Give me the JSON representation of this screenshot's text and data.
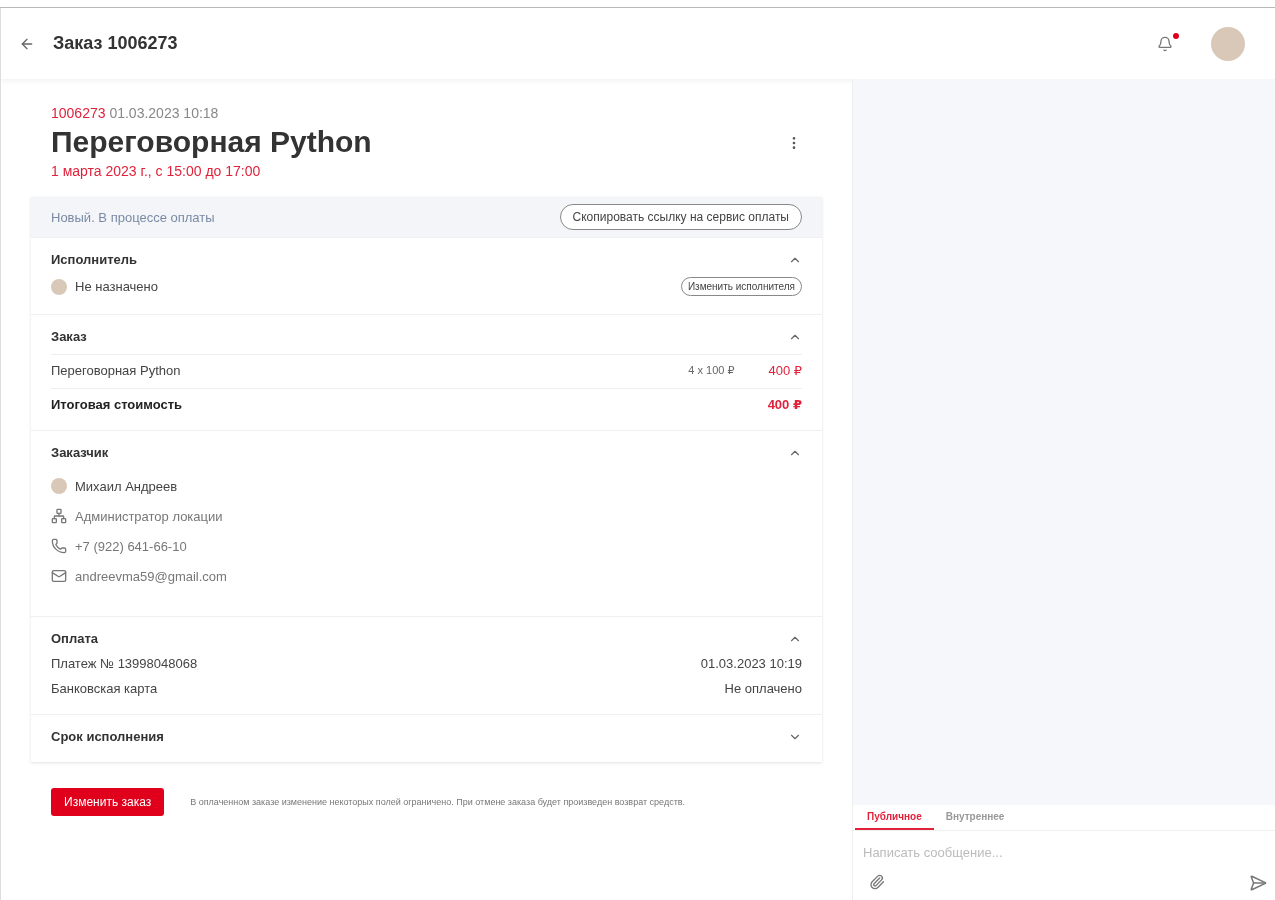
{
  "header": {
    "title": "Заказ 1006273",
    "has_notifications": true
  },
  "order": {
    "number": "1006273",
    "created": "01.03.2023 10:18",
    "title": "Переговорная Python",
    "schedule": "1 марта 2023 г., с 15:00 до 17:00"
  },
  "status_bar": {
    "status": "Новый. В процессе оплаты",
    "button": "Скопировать ссылку на сервис оплаты"
  },
  "sections": [
    {
      "kind": "performer",
      "title": "Исполнитель",
      "expanded": true,
      "name": "Не назначено",
      "button": "Изменить исполнителя"
    },
    {
      "kind": "order",
      "title": "Заказ",
      "expanded": true,
      "items": [
        {
          "name": "Переговорная Python",
          "quantity": "4 x 100 ₽",
          "price": "400 ₽"
        }
      ],
      "total_label": "Итоговая стоимость",
      "total": "400 ₽"
    },
    {
      "kind": "customer",
      "title": "Заказчик",
      "expanded": true,
      "name": "Михаил Андреев",
      "role": "Администратор локации",
      "phone": "+7 (922) 641-66-10",
      "email": "andreevma59@gmail.com"
    },
    {
      "kind": "payment",
      "title": "Оплата",
      "expanded": true,
      "payment": "Платеж № 13998048068",
      "date": "01.03.2023 10:19",
      "method": "Банковская карта",
      "state": "Не оплачено"
    },
    {
      "kind": "deadline",
      "title": "Срок исполнения",
      "expanded": false
    }
  ],
  "footer": {
    "button": "Изменить заказ",
    "note": "В оплаченном заказе изменение некоторых полей ограничено. При отмене заказа будет произведен возврат средств."
  },
  "chat": {
    "tabs": [
      {
        "label": "Публичное",
        "selected": true
      },
      {
        "label": "Внутреннее",
        "selected": false
      }
    ],
    "placeholder": "Написать сообщение..."
  }
}
